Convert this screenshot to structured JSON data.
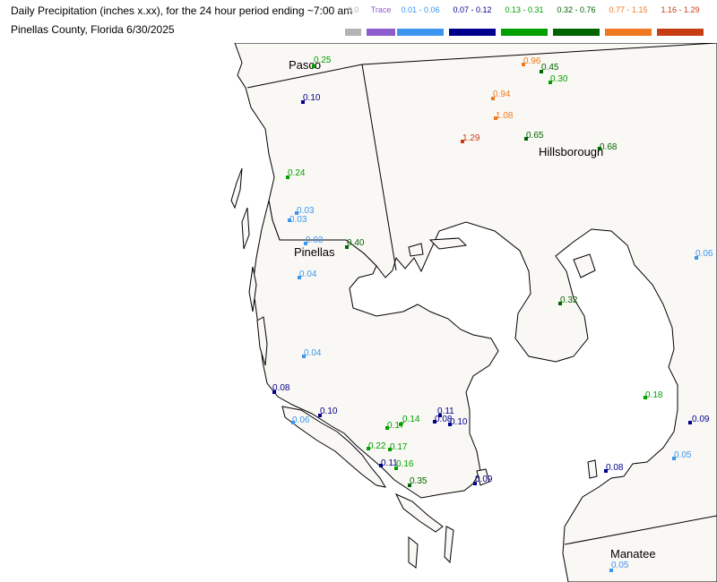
{
  "header": {
    "title_line1": "Daily Precipitation (inches  x.xx),  for the 24 hour period ending ~7:00 am",
    "title_line2": "Pinellas County, Florida  6/30/2025"
  },
  "legend": [
    {
      "label": "0.0",
      "color": "#b4b4b4"
    },
    {
      "label": "Trace",
      "color": "#8f5cd0"
    },
    {
      "label": "0.01 - 0.06",
      "color": "#3c96f0"
    },
    {
      "label": "0.07 - 0.12",
      "color": "#00008c"
    },
    {
      "label": "0.13 - 0.31",
      "color": "#00a000"
    },
    {
      "label": "0.32 - 0.76",
      "color": "#006400"
    },
    {
      "label": "0.77 - 1.15",
      "color": "#f07820"
    },
    {
      "label": "1.16 - 1.29",
      "color": "#c83c14"
    }
  ],
  "colors": {
    "land": "#faf8f4",
    "water": "#ffffff",
    "coastline": "#000000"
  },
  "counties": [
    "Pasco",
    "Hillsborough",
    "Pinellas",
    "Manatee"
  ],
  "stations": [
    {
      "value": "0.25",
      "cls": 4
    },
    {
      "value": "0.10",
      "cls": 3
    },
    {
      "value": "0.24",
      "cls": 4
    },
    {
      "value": "0.03",
      "cls": 2
    },
    {
      "value": "0.03",
      "cls": 2
    },
    {
      "value": "0.03",
      "cls": 2
    },
    {
      "value": "0.40",
      "cls": 5
    },
    {
      "value": "0.04",
      "cls": 2
    },
    {
      "value": "0.04",
      "cls": 2
    },
    {
      "value": "0.08",
      "cls": 3
    },
    {
      "value": "0.06",
      "cls": 2
    },
    {
      "value": "0.10",
      "cls": 3
    },
    {
      "value": "0.17",
      "cls": 4
    },
    {
      "value": "0.14",
      "cls": 4
    },
    {
      "value": "0.08",
      "cls": 3
    },
    {
      "value": "0.11",
      "cls": 3
    },
    {
      "value": "0.10",
      "cls": 3
    },
    {
      "value": "0.22",
      "cls": 4
    },
    {
      "value": "0.17",
      "cls": 4
    },
    {
      "value": "0.11",
      "cls": 3
    },
    {
      "value": "0.16",
      "cls": 4
    },
    {
      "value": "0.35",
      "cls": 5
    },
    {
      "value": "0.09",
      "cls": 3
    },
    {
      "value": "0.96",
      "cls": 6
    },
    {
      "value": "0.45",
      "cls": 5
    },
    {
      "value": "0.30",
      "cls": 4
    },
    {
      "value": "0.94",
      "cls": 6
    },
    {
      "value": "1.08",
      "cls": 6
    },
    {
      "value": "1.29",
      "cls": 7
    },
    {
      "value": "0.65",
      "cls": 5
    },
    {
      "value": "0.68",
      "cls": 5
    },
    {
      "value": "0.32",
      "cls": 5
    },
    {
      "value": "0.18",
      "cls": 4
    },
    {
      "value": "0.09",
      "cls": 3
    },
    {
      "value": "0.05",
      "cls": 2
    },
    {
      "value": "0.08",
      "cls": 3
    },
    {
      "value": "0.05",
      "cls": 2
    },
    {
      "value": "0.06",
      "cls": 2
    }
  ]
}
